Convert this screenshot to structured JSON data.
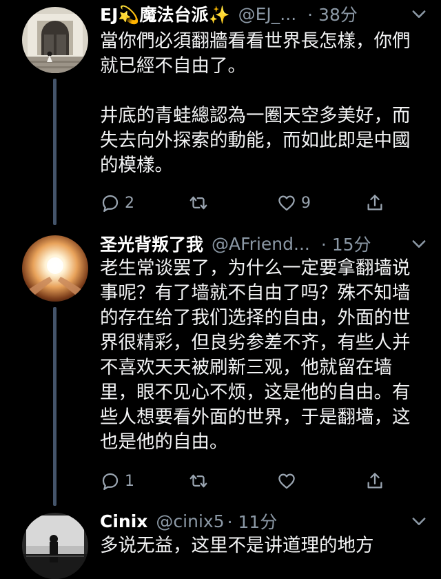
{
  "tweets": [
    {
      "name": "EJ💫魔法台派✨",
      "handle": "@EJ_...",
      "time": "· 38分",
      "text": "當你們必須翻牆看看世界長怎樣，你們就已經不自由了。\n\n井底的青蛙總認為一圈天空多美好，而失去向外探索的動能，而如此即是中國的模樣。",
      "replies": "2",
      "retweets": "",
      "likes": "9"
    },
    {
      "name": "圣光背叛了我",
      "handle": "@AFriend...",
      "time": "· 15分",
      "text": "老生常谈罢了，为什么一定要拿翻墙说事呢？有了墙就不自由了吗？殊不知墙的存在给了我们选择的自由，外面的世界很精彩，但良劣参差不齐，有些人并不喜欢天天被刷新三观，他就留在墙里，眼不见心不烦，这是他的自由。有些人想要看外面的世界，于是翻墙，这也是他的自由。",
      "replies": "1",
      "retweets": "",
      "likes": ""
    },
    {
      "name": "Cinix",
      "handle": "@cinix5",
      "time": "· 11分",
      "text": "多说无益，这里不是讲道理的地方"
    }
  ],
  "icons": {
    "reply": "reply-icon",
    "retweet": "retweet-icon",
    "like": "heart-icon",
    "share": "share-icon",
    "more": "chevron-down-icon"
  },
  "colors": {
    "background": "#000000",
    "text": "#f3f4f5",
    "muted": "#8b98a5",
    "thread_line": "#44546a"
  }
}
